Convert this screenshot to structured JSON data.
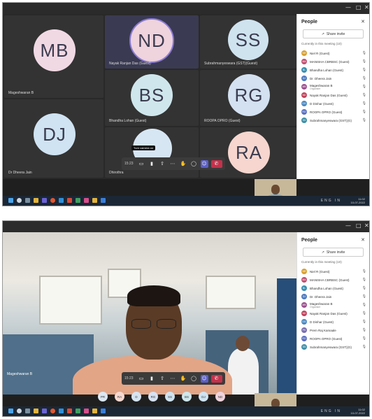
{
  "colors": {
    "accent": "#5b5fc7",
    "leave": "#c4314b",
    "tile": "#333333",
    "panel": "#ffffff"
  },
  "top": {
    "tiles": [
      {
        "initials": "MB",
        "name": "Mageshwaran B",
        "bg": "#f1d9e4"
      },
      {
        "initials": "ND",
        "name": "Nayak Ranjan Das (Guest)",
        "bg": "#efd3dd"
      },
      {
        "initials": "SS",
        "name": "Subrahmanyeswara (GST)(Guest)",
        "bg": "#cfe3ef"
      },
      {
        "initials": "BS",
        "name": "Bhandha Lohan (Guest)",
        "bg": "#cfe7ec"
      },
      {
        "initials": "RG",
        "name": "ROOPA OPRO (Guest)",
        "bg": "#d3e1f1"
      },
      {
        "initials": "DJ",
        "name": "Dr Dheera Jain",
        "bg": "#cfe3f2"
      },
      {
        "initials": "",
        "name": "Dhirothra",
        "bg": "#d7e6f3"
      },
      {
        "initials": "RA",
        "name": "",
        "bg": "#f6d6cf"
      }
    ],
    "timer": "15:23",
    "tooltip": "Turn camera on"
  },
  "bottom": {
    "video_name": "Mageshwaran B",
    "timer": "15:23",
    "strip": [
      {
        "initials": "PR",
        "bg": "#dbe7f2"
      },
      {
        "initials": "RA",
        "bg": "#f5d8d0"
      },
      {
        "initials": "D",
        "bg": "#d6e4f1"
      },
      {
        "initials": "RG",
        "bg": "#d6e1f1"
      },
      {
        "initials": "SS",
        "bg": "#cfe3ef"
      },
      {
        "initials": "BS",
        "bg": "#cfe7ec"
      },
      {
        "initials": "DJ",
        "bg": "#cfe3f2"
      },
      {
        "initials": "ND",
        "bg": "#efd3dd"
      }
    ]
  },
  "panel": {
    "title": "People",
    "invite": "Share invite",
    "in_meeting_top": "Currently in this meeting (10)",
    "in_meeting_bottom": "Currently in this meeting (10)",
    "people_top": [
      {
        "initials": "NR",
        "name": "Niel R (Guest)",
        "color": "#d8a030"
      },
      {
        "initials": "MA",
        "name": "MANISHA CBRBSC (Guest)",
        "color": "#c05070"
      },
      {
        "initials": "BL",
        "name": "Bhandha Lohan (Guest)",
        "color": "#3a8fb0"
      },
      {
        "initials": "DJ",
        "name": "Dr. Dheera Jain",
        "color": "#4d7bbf"
      },
      {
        "initials": "MB",
        "name": "Mageshwaran B",
        "sub": "Organiser",
        "color": "#9b4f8f"
      },
      {
        "initials": "ND",
        "name": "Nayak Ranjan Das (Guest)",
        "color": "#c0405a"
      },
      {
        "initials": "DG",
        "name": "D Dinhar (Guest)",
        "color": "#4a88c0"
      },
      {
        "initials": "RO",
        "name": "ROOPA OPRO (Guest)",
        "color": "#5a6fc0"
      },
      {
        "initials": "SS",
        "name": "Subrahmanyeswara (GST)(G)",
        "color": "#3f8fa8"
      }
    ],
    "people_bottom": [
      {
        "initials": "NR",
        "name": "Niel R (Guest)",
        "color": "#d8a030"
      },
      {
        "initials": "MA",
        "name": "MANISHA CBRBSC (Guest)",
        "color": "#c05070"
      },
      {
        "initials": "BL",
        "name": "Bhandha Lohan (Guest)",
        "color": "#3a8fb0"
      },
      {
        "initials": "DJ",
        "name": "Dr. Dheera Jain",
        "color": "#4d7bbf"
      },
      {
        "initials": "MB",
        "name": "Mageshwaran B",
        "sub": "Organiser",
        "color": "#9b4f8f"
      },
      {
        "initials": "ND",
        "name": "Nayak Ranjan Das (Guest)",
        "color": "#c0405a"
      },
      {
        "initials": "DG",
        "name": "D Dinhar (Guest)",
        "color": "#4a88c0"
      },
      {
        "initials": "PK",
        "name": "Prem Raj Kamaale",
        "color": "#7a6fb0"
      },
      {
        "initials": "RO",
        "name": "ROOPA OPRO (Guest)",
        "color": "#5a6fc0"
      },
      {
        "initials": "SS",
        "name": "Subrahmanyeswara (GST)(G)",
        "color": "#3f8fa8"
      }
    ]
  },
  "taskbar": {
    "clock_time": "11:02",
    "clock_date": "10-07-2022",
    "lang": "ENG IN"
  },
  "window_controls": [
    "—",
    "□",
    "✕"
  ]
}
